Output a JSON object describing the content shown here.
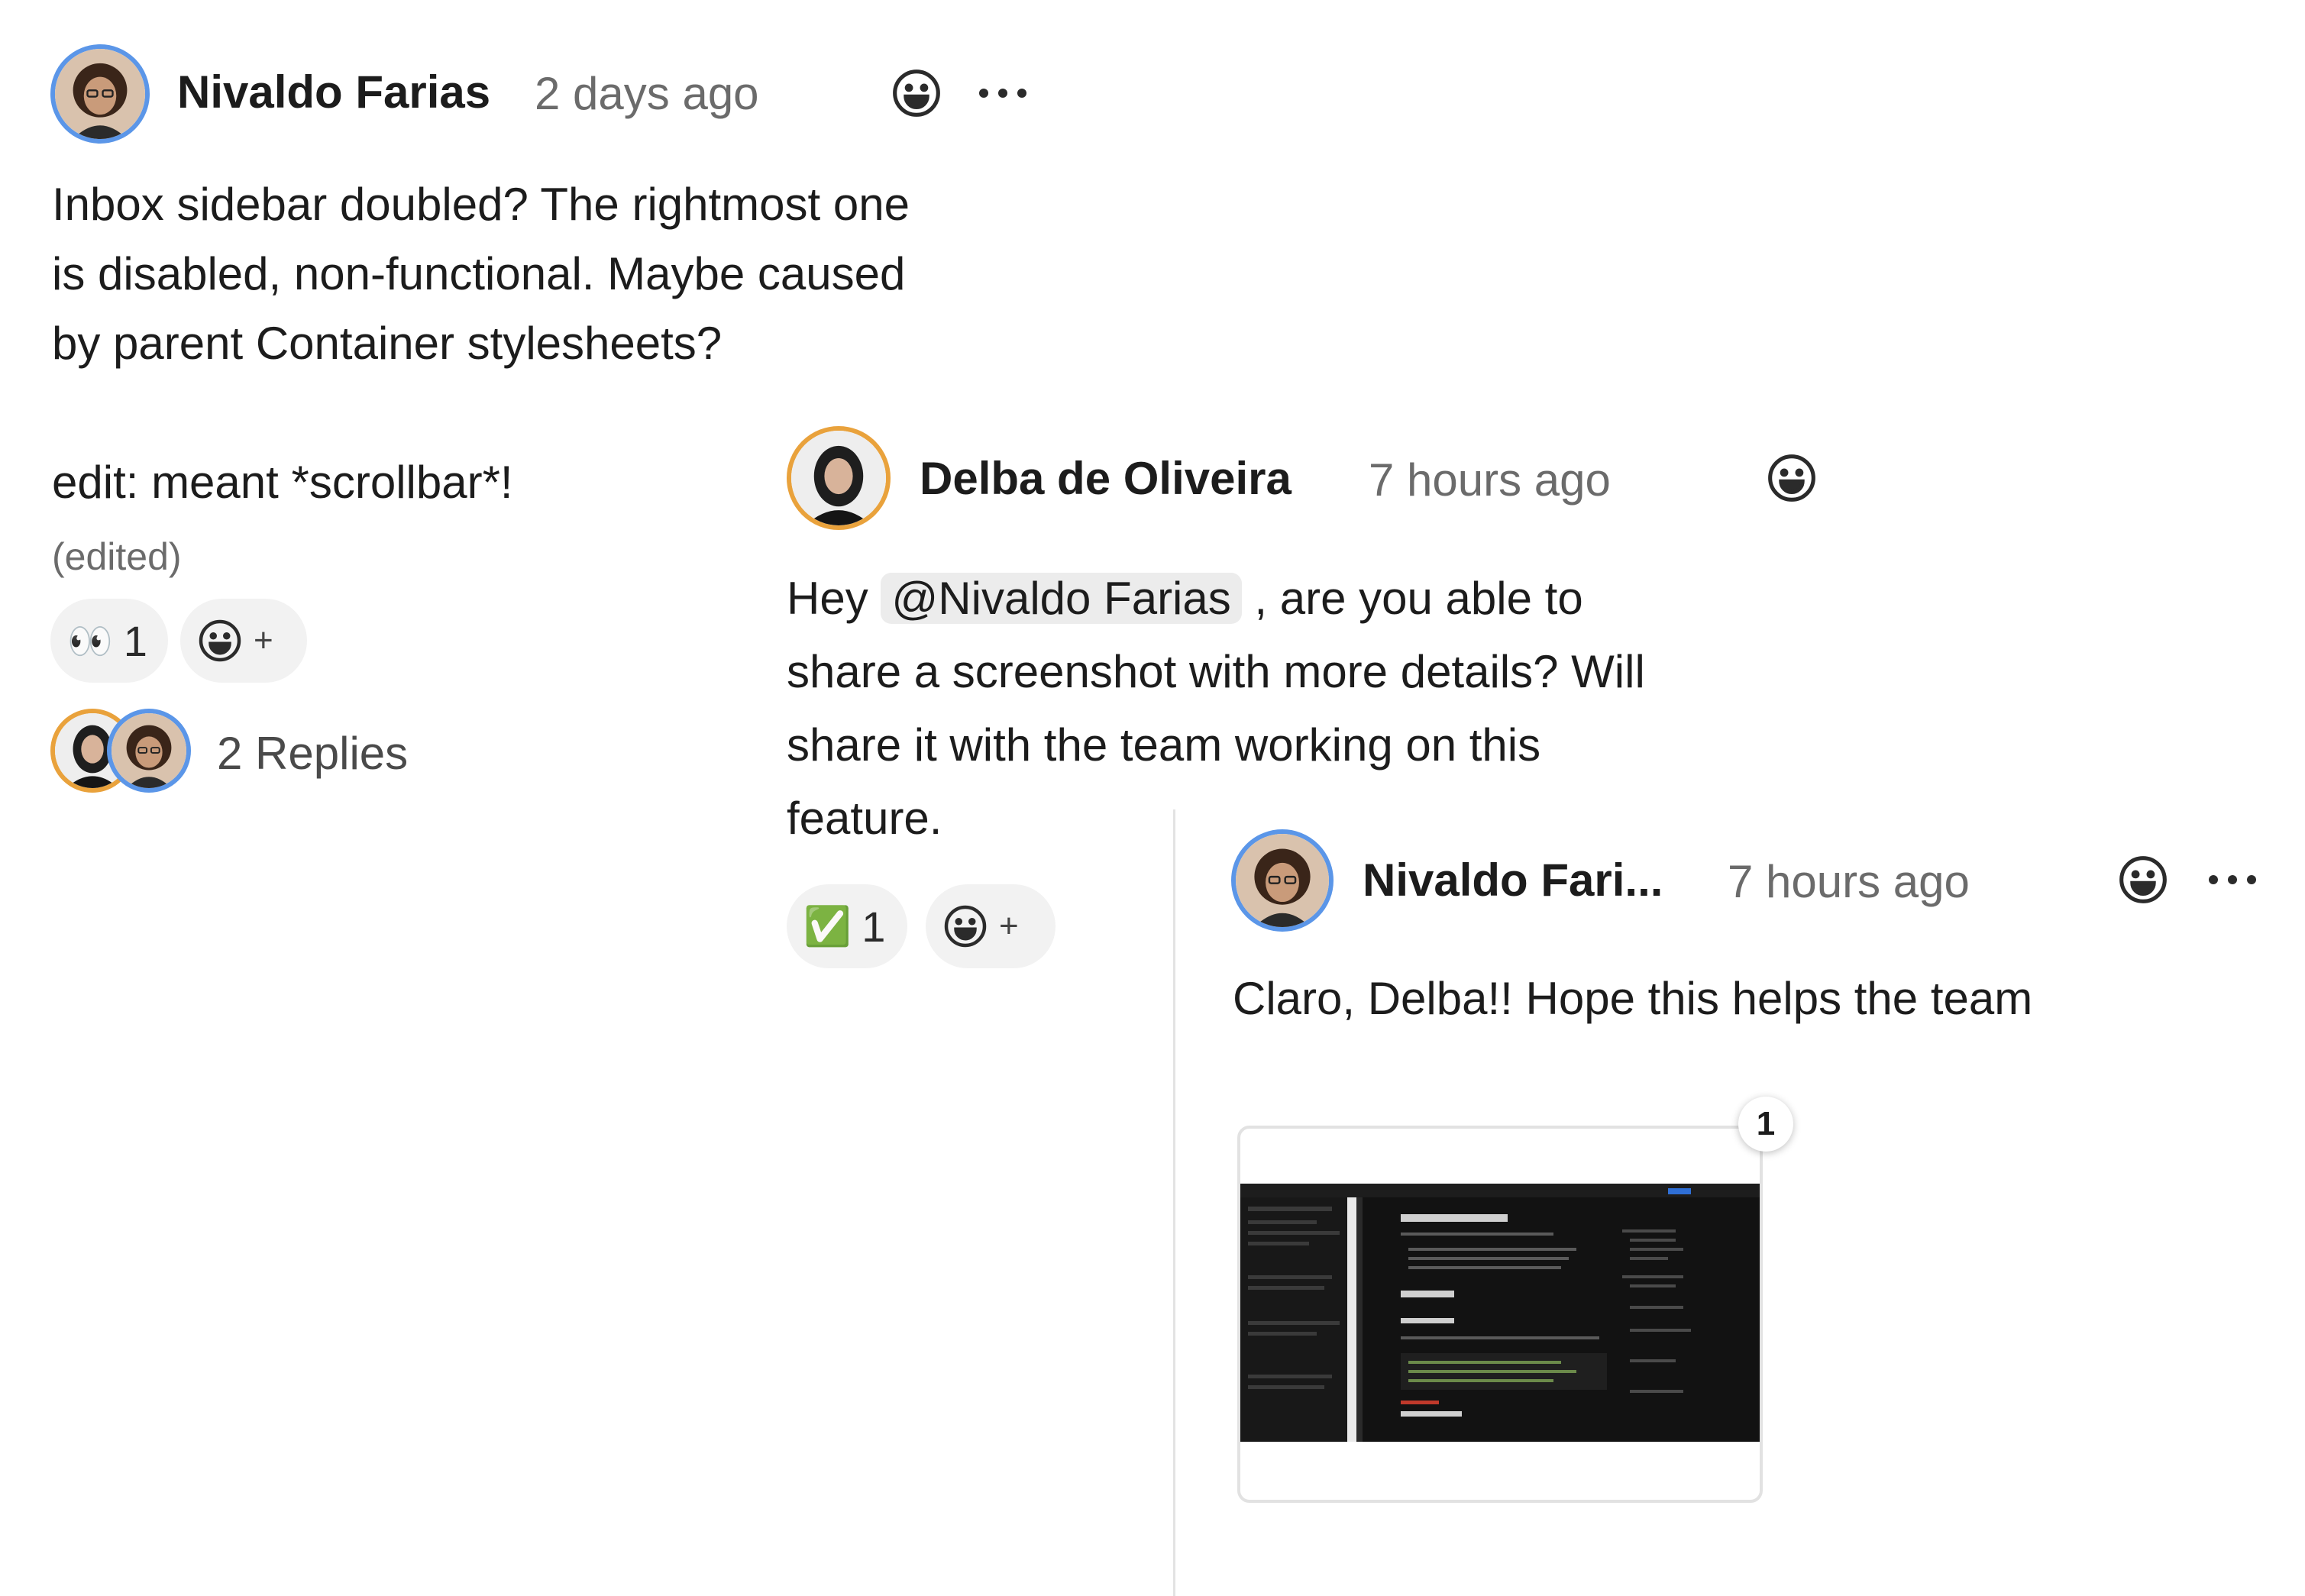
{
  "comments": [
    {
      "author": "Nivaldo Farias",
      "time": "2 days ago",
      "lines": [
        "Inbox sidebar doubled? The rightmost one",
        "is disabled, non-functional. Maybe caused",
        "by parent Container stylesheets?"
      ],
      "edit_note": "edit: meant *scrollbar*!",
      "edited_label": "(edited)",
      "reaction": {
        "emoji": "👀",
        "count": "1"
      },
      "add_reaction_plus": "+",
      "replies_label": "2 Replies"
    },
    {
      "author": "Delba de Oliveira",
      "time": "7 hours ago",
      "line1_before": "Hey",
      "mention": "@Nivaldo Farias",
      "line1_after": ", are you able to",
      "lines": [
        "share a screenshot with more details? Will",
        "share it with the team working on this",
        "feature."
      ],
      "reaction": {
        "emoji": "✅",
        "count": "1"
      },
      "add_reaction_plus": "+"
    },
    {
      "author": "Nivaldo Fari...",
      "time": "7 hours ago",
      "text": "Claro, Delba!! Hope this helps the team",
      "attachment_badge": "1"
    }
  ],
  "colors": {
    "nivaldo_ring": "#5b96e8",
    "delba_ring": "#e9a23c",
    "meta_text": "#6b6b6b"
  },
  "icons": [
    "add-reaction-icon",
    "more-options-icon",
    "smiley-icon"
  ]
}
